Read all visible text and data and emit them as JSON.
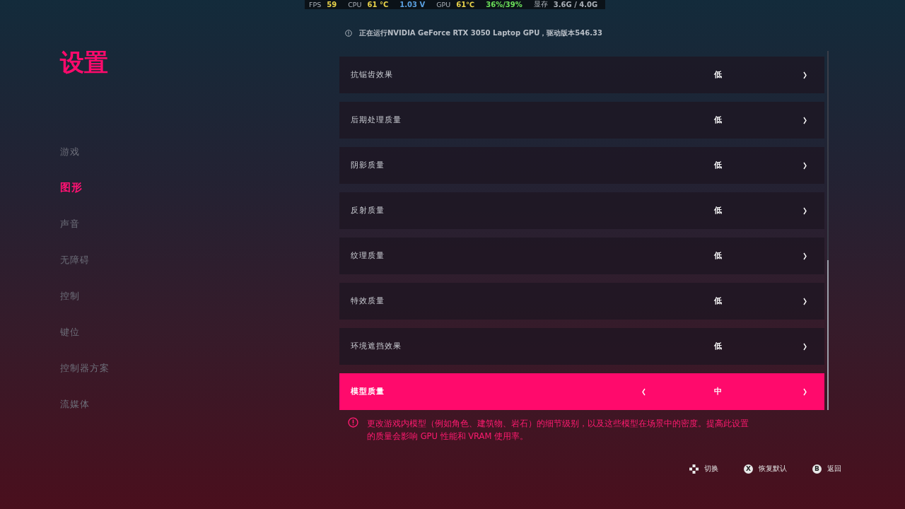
{
  "overlay": [
    {
      "label": "FPS",
      "value": "59",
      "color": "#e8d24a"
    },
    {
      "label": "CPU",
      "value": "61 °C",
      "color": "#e8d24a"
    },
    {
      "value": "1.03 V",
      "color": "#5aa0e0"
    },
    {
      "label": "GPU",
      "value": "61℃",
      "color": "#e8d24a"
    },
    {
      "value": "36%/39%",
      "color": "#6be05a"
    },
    {
      "label": "显存",
      "value": "3.6G / 4.0G",
      "color": "#aab0b8"
    }
  ],
  "title": "设置",
  "sidebar": {
    "items": [
      {
        "label": "游戏",
        "selected": false
      },
      {
        "label": "图形",
        "selected": true
      },
      {
        "label": "声音",
        "selected": false
      },
      {
        "label": "无障碍",
        "selected": false
      },
      {
        "label": "控制",
        "selected": false
      },
      {
        "label": "键位",
        "selected": false
      },
      {
        "label": "控制器方案",
        "selected": false
      },
      {
        "label": "流媒体",
        "selected": false
      }
    ]
  },
  "gpu_info": "正在运行NVIDIA GeForce RTX 3050 Laptop GPU，驱动版本546.33",
  "settings": [
    {
      "label": "抗锯齿效果",
      "value": "低",
      "selected": false
    },
    {
      "label": "后期处理质量",
      "value": "低",
      "selected": false
    },
    {
      "label": "阴影质量",
      "value": "低",
      "selected": false
    },
    {
      "label": "反射质量",
      "value": "低",
      "selected": false
    },
    {
      "label": "纹理质量",
      "value": "低",
      "selected": false
    },
    {
      "label": "特效质量",
      "value": "低",
      "selected": false
    },
    {
      "label": "环境遮挡效果",
      "value": "低",
      "selected": false
    },
    {
      "label": "模型质量",
      "value": "中",
      "selected": true
    }
  ],
  "description": "更改游戏内模型（例如角色、建筑物、岩石）的细节级别，以及这些模型在场景中的密度。提高此设置的质量会影响 GPU 性能和 VRAM 使用率。",
  "hints": [
    {
      "kind": "dpad",
      "label": "切换"
    },
    {
      "kind": "button",
      "glyph": "X",
      "label": "恢复默认"
    },
    {
      "kind": "button",
      "glyph": "B",
      "label": "返回"
    }
  ]
}
